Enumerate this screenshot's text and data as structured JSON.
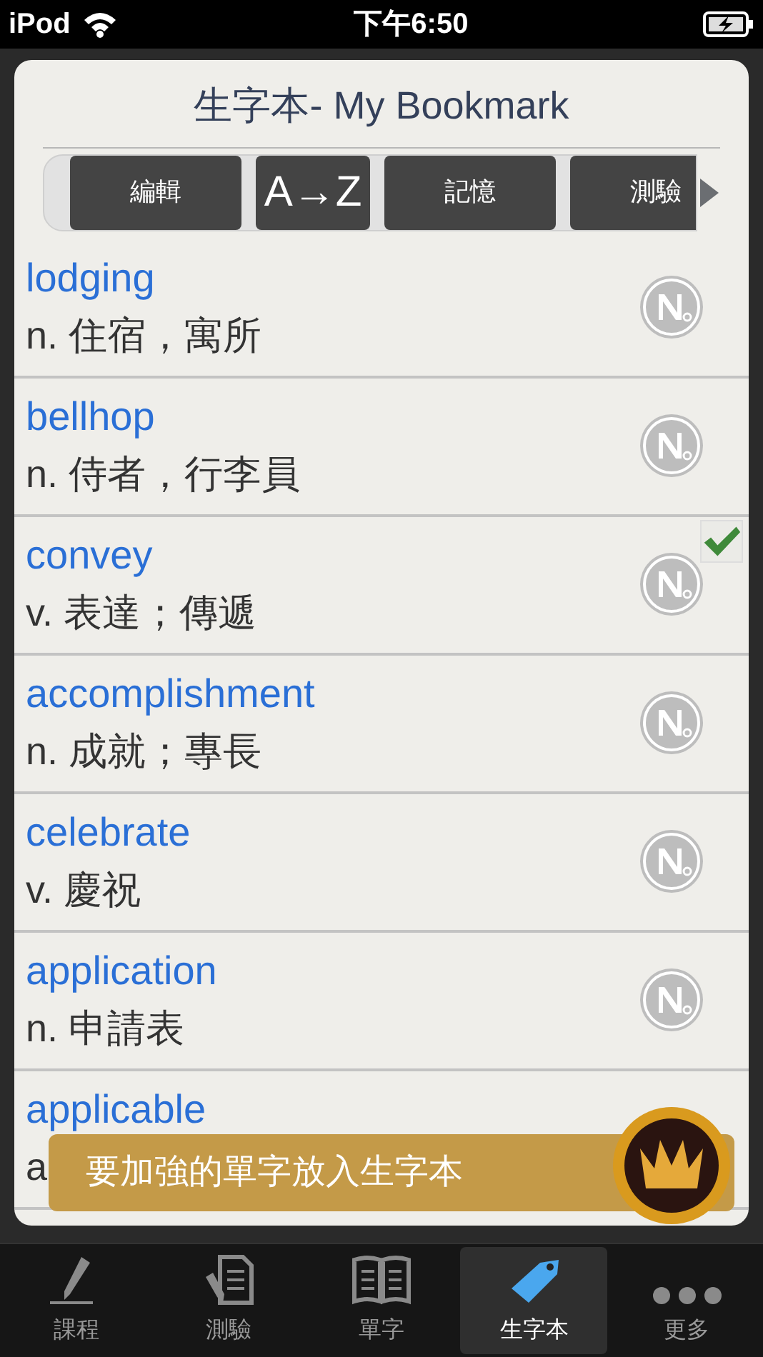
{
  "status_bar": {
    "device": "iPod",
    "time": "下午6:50"
  },
  "title": "生字本- My Bookmark",
  "toolbar": [
    {
      "label": "編輯",
      "kind": "text"
    },
    {
      "label": "A→Z",
      "kind": "large"
    },
    {
      "label": "記憶",
      "kind": "text"
    },
    {
      "label": "測驗",
      "kind": "text"
    }
  ],
  "words": [
    {
      "word": "lodging",
      "definition": "n. 住宿，寓所",
      "checked": false
    },
    {
      "word": "bellhop",
      "definition": "n. 侍者，行李員",
      "checked": false
    },
    {
      "word": "convey",
      "definition": "v. 表達；傳遞",
      "checked": true
    },
    {
      "word": "accomplishment",
      "definition": "n. 成就；專長",
      "checked": false
    },
    {
      "word": "celebrate",
      "definition": "v. 慶祝",
      "checked": false
    },
    {
      "word": "application",
      "definition": "n. 申請表",
      "checked": false
    },
    {
      "word": "applicable",
      "definition": "a",
      "checked": false
    }
  ],
  "banner": "要加強的單字放入生字本",
  "tab_bar": [
    {
      "label": "課程",
      "kind": "pencil",
      "selected": false
    },
    {
      "label": "測驗",
      "kind": "quiz",
      "selected": false
    },
    {
      "label": "單字",
      "kind": "book",
      "selected": false
    },
    {
      "label": "生字本",
      "kind": "tag",
      "selected": true
    },
    {
      "label": "更多",
      "kind": "more",
      "selected": false
    }
  ]
}
